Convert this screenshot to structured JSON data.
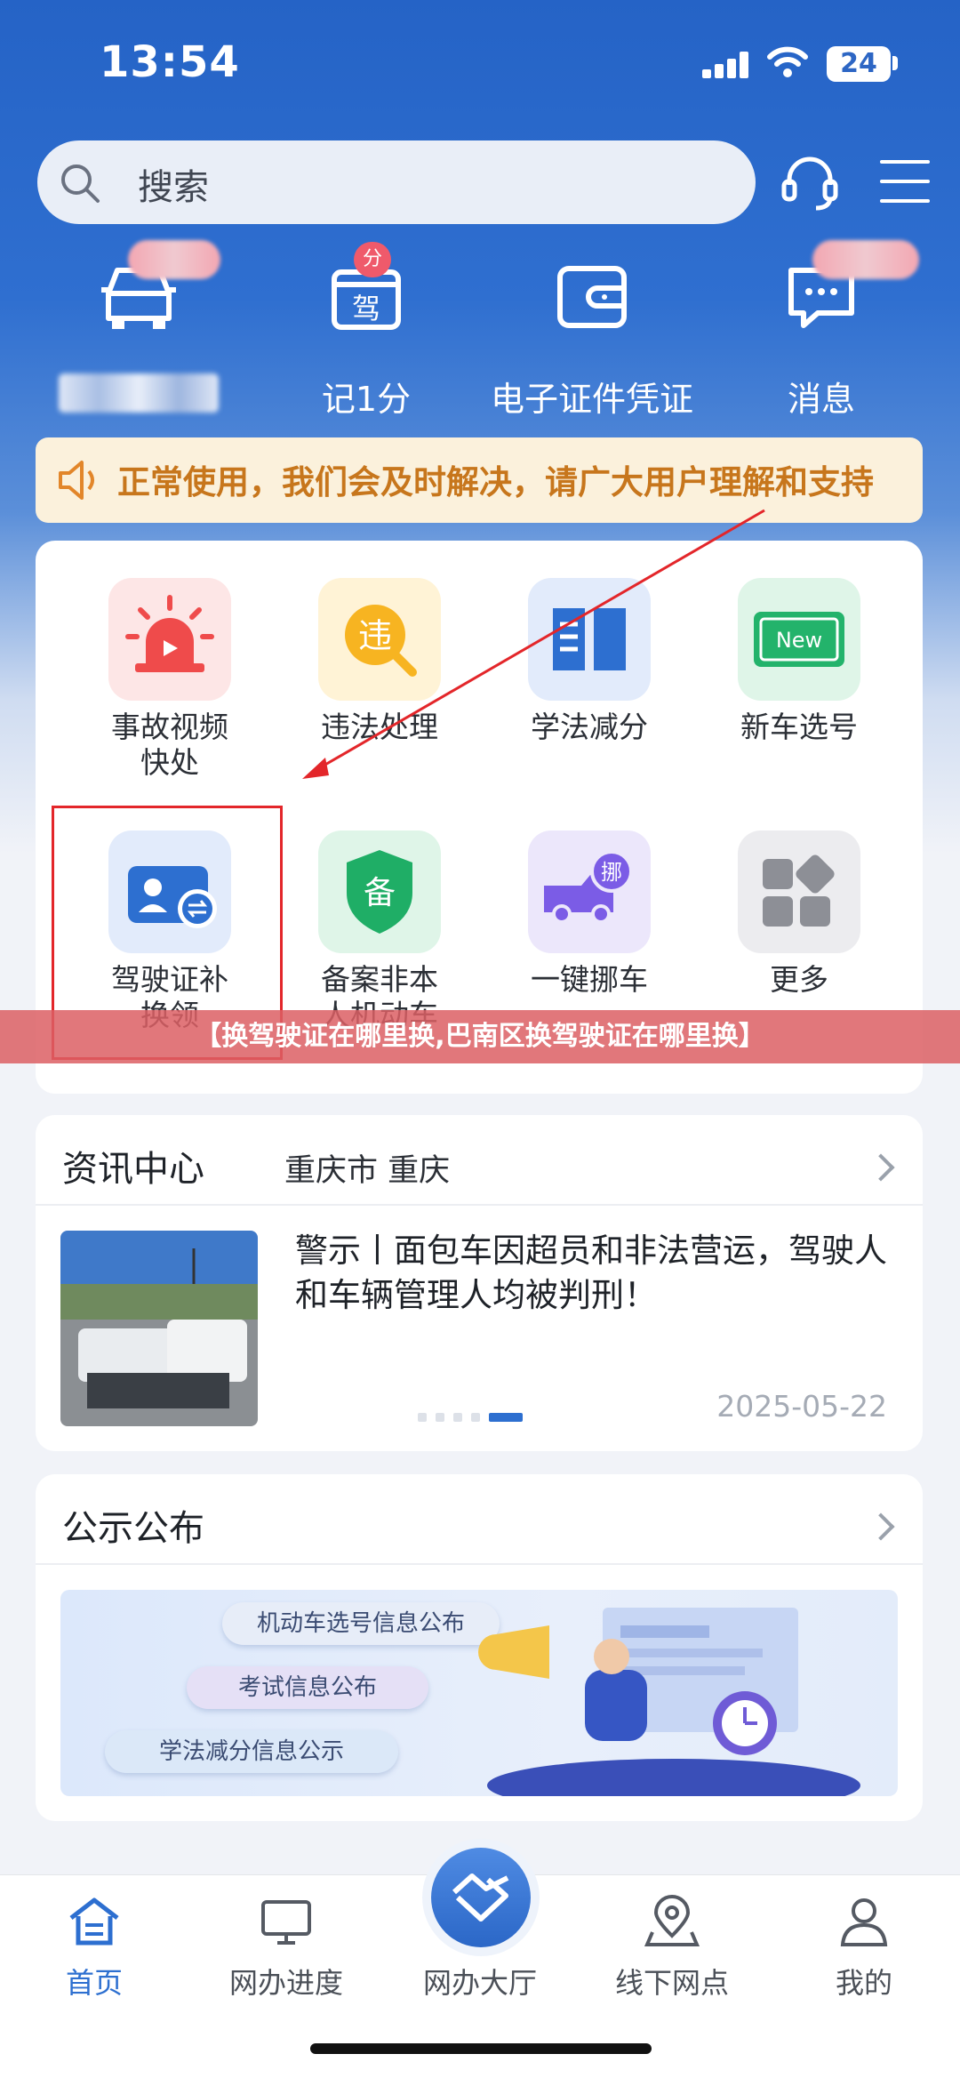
{
  "status": {
    "time": "13:54",
    "battery": "24"
  },
  "search": {
    "placeholder": "搜索"
  },
  "quick_entries": [
    {
      "label": "",
      "icon": "car-icon",
      "badge": ""
    },
    {
      "label": "记1分",
      "icon": "driver-score-icon",
      "badge": "分"
    },
    {
      "label": "电子证件凭证",
      "icon": "wallet-icon",
      "badge": ""
    },
    {
      "label": "消息",
      "icon": "message-icon",
      "badge": ""
    }
  ],
  "notice": {
    "text": "正常使用，我们会及时解决，请广大用户理解和支持"
  },
  "services": [
    {
      "label": "事故视频快处",
      "icon": "alarm-video-icon"
    },
    {
      "label": "违法处理",
      "icon": "violation-icon",
      "glyph": "违"
    },
    {
      "label": "学法减分",
      "icon": "book-icon"
    },
    {
      "label": "新车选号",
      "icon": "new-plate-icon",
      "glyph": "New"
    },
    {
      "label": "驾驶证补换领",
      "icon": "license-renew-icon"
    },
    {
      "label": "备案非本人机动车",
      "icon": "shield-record-icon",
      "glyph": "备"
    },
    {
      "label": "一键挪车",
      "icon": "move-car-icon",
      "glyph": "挪"
    },
    {
      "label": "更多",
      "icon": "more-grid-icon"
    }
  ],
  "news": {
    "title": "资讯中心",
    "location": "重庆市 重庆",
    "headline": "警示丨面包车因超员和非法营运，驾驶人和车辆管理人均被判刑！",
    "date": "2025-05-22"
  },
  "announcements": {
    "title": "公示公布",
    "pills": [
      "机动车选号信息公布",
      "考试信息公布",
      "学法减分信息公示"
    ]
  },
  "bottom_nav": [
    {
      "label": "首页",
      "icon": "home-icon",
      "active": true
    },
    {
      "label": "网办进度",
      "icon": "monitor-icon",
      "active": false
    },
    {
      "label": "网办大厅",
      "icon": "handshake-icon",
      "active": false
    },
    {
      "label": "线下网点",
      "icon": "location-icon",
      "active": false
    },
    {
      "label": "我的",
      "icon": "user-icon",
      "active": false
    }
  ],
  "caption": "【换驾驶证在哪里换,巴南区换驾驶证在哪里换】",
  "colors": {
    "primary": "#2d6fd0",
    "notice": "#c7761c",
    "annotation": "#e3262a"
  }
}
